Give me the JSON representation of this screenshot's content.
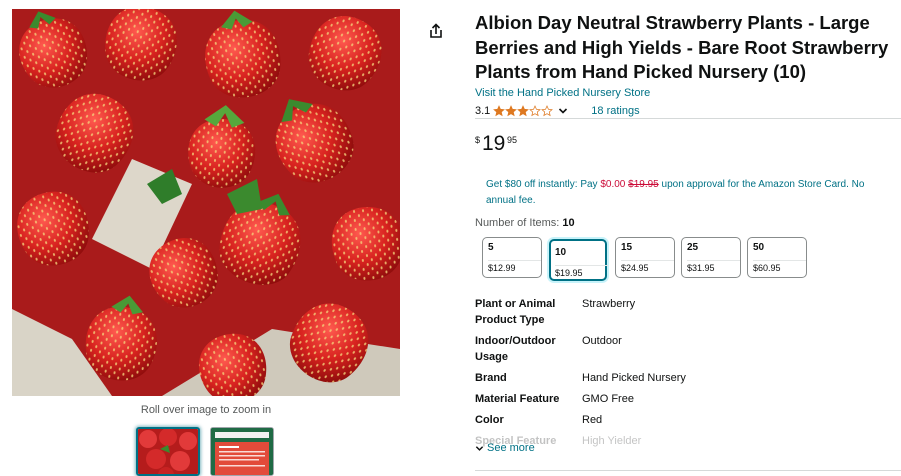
{
  "product": {
    "title": "Albion Day Neutral Strawberry Plants - Large Berries and High Yields - Bare Root Strawberry Plants from Hand Picked Nursery (10)",
    "store_link": "Visit the Hand Picked Nursery Store",
    "rating": "3.1",
    "rating_stars": 3,
    "ratings_count": "18 ratings"
  },
  "gallery": {
    "zoom_hint": "Roll over image to zoom in"
  },
  "price": {
    "symbol": "$",
    "whole": "19",
    "fraction": "95"
  },
  "promo": {
    "pre": "Get $80 off instantly: Pay ",
    "pay": "$0.00",
    "strike": "$19.95",
    "post": " upon approval for the Amazon Store Card. No annual fee."
  },
  "options": {
    "label": "Number of Items: ",
    "selected_value": "10",
    "items": [
      {
        "name": "5",
        "price": "$12.99"
      },
      {
        "name": "10",
        "price": "$19.95"
      },
      {
        "name": "15",
        "price": "$24.95"
      },
      {
        "name": "25",
        "price": "$31.95"
      },
      {
        "name": "50",
        "price": "$60.95"
      }
    ]
  },
  "specs": [
    {
      "key": "Plant or Animal Product Type",
      "value": "Strawberry"
    },
    {
      "key": "Indoor/Outdoor Usage",
      "value": "Outdoor"
    },
    {
      "key": "Brand",
      "value": "Hand Picked Nursery"
    },
    {
      "key": "Material Feature",
      "value": "GMO Free"
    },
    {
      "key": "Color",
      "value": "Red"
    },
    {
      "key": "Special Feature",
      "value": "High Yielder"
    }
  ],
  "see_more": "See more",
  "colors": {
    "link": "#007185",
    "star": "#de7921",
    "promo_red": "#cc0c39"
  }
}
